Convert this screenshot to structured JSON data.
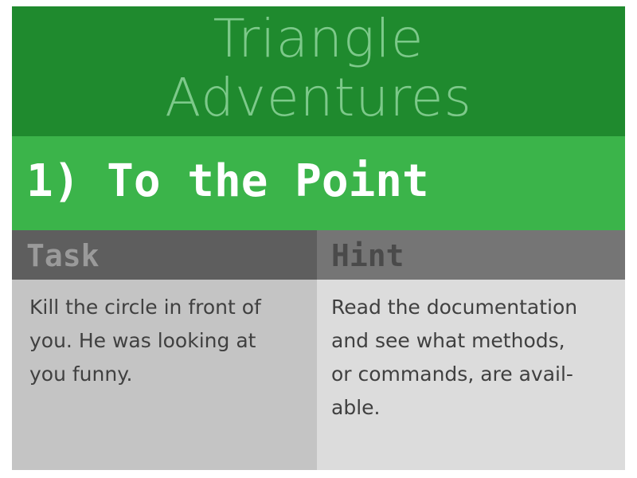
{
  "game_title": {
    "line1": "Triangle",
    "line2": "Adventures"
  },
  "level": {
    "title": "1) To the Point"
  },
  "task": {
    "header": "Task",
    "lines": [
      "Kill the circle in front of",
      "you. He was looking at",
      "you funny."
    ]
  },
  "hint": {
    "header": "Hint",
    "lines": [
      "Read the documentation",
      "and see what methods,",
      "or commands, are avail-",
      "able."
    ]
  },
  "colors": {
    "title_band": "#1f8a2e",
    "title_text": "#7dc98a",
    "level_band": "#3bb44a",
    "task_header": "#5e5e5e",
    "hint_header": "#757575",
    "task_body": "#c4c4c4",
    "hint_body": "#dcdcdc"
  }
}
